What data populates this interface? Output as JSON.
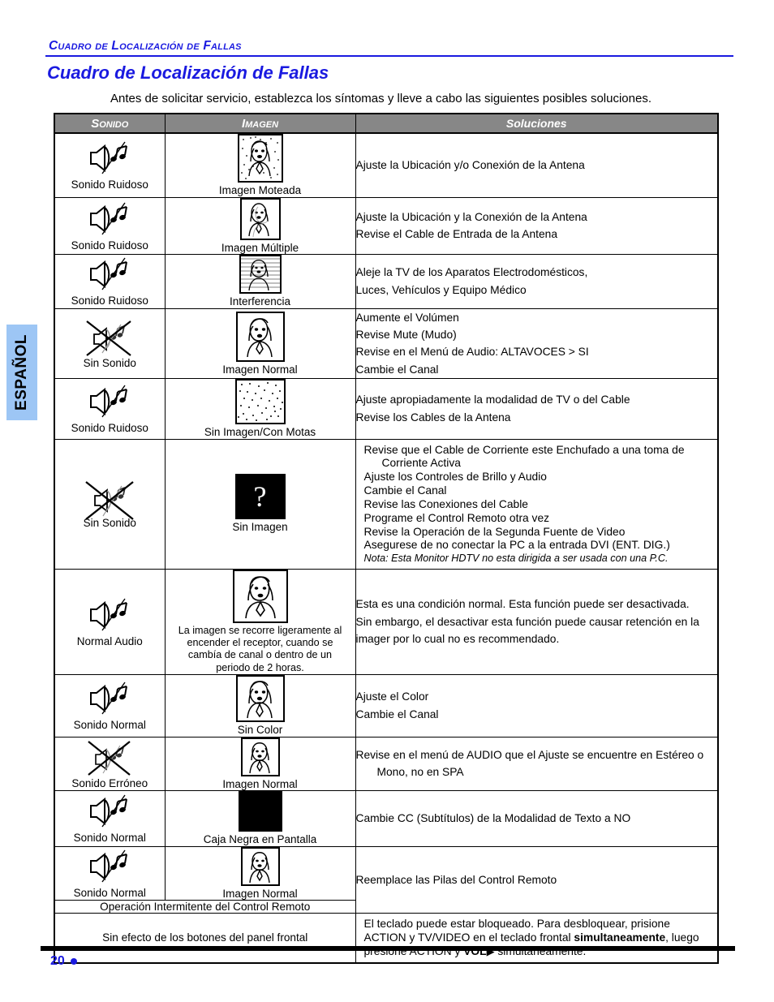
{
  "language_tab": {
    "label": "ESPAÑOL"
  },
  "header": {
    "running_head": "Cuadro de Localización de Fallas",
    "title": "Cuadro de Localización de Fallas",
    "intro": "Antes de solicitar servicio, establezca los síntomas y lleve a cabo las siguientes posibles soluciones."
  },
  "table": {
    "columns": [
      "Sonido",
      "Imagen",
      "Soluciones"
    ],
    "rows": [
      {
        "sound_icon": "speaker-noisy-icon",
        "sound_label": "Sonido Ruidoso",
        "picture_icon": "face-speckled-icon",
        "picture_label": "Imagen Moteada",
        "solutions": [
          "Ajuste la Ubicación y/o Conexión de la Antena"
        ]
      },
      {
        "sound_icon": "speaker-noisy-icon",
        "sound_label": "Sonido Ruidoso",
        "picture_icon": "face-ghost-icon",
        "picture_label": "Imagen Múltiple",
        "solutions": [
          "Ajuste la Ubicación y la Conexión de la Antena",
          "Revise el Cable de Entrada de la Antena"
        ]
      },
      {
        "sound_icon": "speaker-noisy-icon",
        "sound_label": "Sonido Ruidoso",
        "picture_icon": "face-interference-icon",
        "picture_label": "Interferencia",
        "solutions": [
          "Aleje la TV de los Aparatos Electrodomésticos,",
          "Luces, Vehículos y Equipo Médico"
        ]
      },
      {
        "sound_icon": "speaker-muted-icon",
        "sound_label": "Sin Sonido",
        "picture_icon": "face-normal-icon",
        "picture_label": "Imagen Normal",
        "solutions": [
          "Aumente el Volúmen",
          "Revise Mute (Mudo)",
          "Revise en el Menú de Audio: ALTAVOCES > SI",
          "Cambie el Canal"
        ]
      },
      {
        "sound_icon": "speaker-noisy-icon",
        "sound_label": "Sonido Ruidoso",
        "picture_icon": "snow-icon",
        "picture_label": "Sin Imagen/Con Motas",
        "solutions": [
          "Ajuste apropiadamente la modalidad de TV o del Cable",
          "Revise los Cables de la Antena"
        ]
      },
      {
        "sound_icon": "speaker-muted-icon",
        "sound_label": "Sin Sonido",
        "picture_icon": "question-box-icon",
        "picture_label": "Sin Imagen",
        "solutions": [
          "Revise que el Cable de Corriente este Enchufado a una toma de",
          "Corriente Activa",
          "Ajuste los Controles de Brillo y Audio",
          "Cambie el Canal",
          "Revise las Conexiones del Cable",
          "Programe el Control Remoto otra vez",
          "Revise la Operación de la Segunda Fuente de Video",
          "Asegurese de no conectar la PC a la entrada DVI (ENT. DIG.)"
        ],
        "note": "Nota:  Esta Monitor HDTV no esta dirigida a ser usada con una P.C."
      },
      {
        "sound_icon": "speaker-noisy-icon",
        "sound_label": "Normal Audio",
        "picture_icon": "face-normal-icon",
        "picture_label": "La imagen se recorre ligeramente al encender el receptor, cuando se cambía de canal o dentro de un periodo de 2 horas.",
        "solutions": [
          "Esta es una condición normal. Esta función puede ser desactivada.",
          "Sin embargo, el desactivar esta función puede causar retención en la",
          "imager por lo cual no es recommendado."
        ]
      },
      {
        "sound_icon": "speaker-noisy-icon",
        "sound_label": "Sonido Normal",
        "picture_icon": "face-normal-icon",
        "picture_label": "Sin Color",
        "solutions": [
          "Ajuste el Color",
          "Cambie el Canal"
        ]
      },
      {
        "sound_icon": "speaker-muted-icon",
        "sound_label": "Sonido Erróneo",
        "picture_icon": "face-normal-icon",
        "picture_label": "Imagen Normal",
        "solutions": [
          "Revise en el menú de AUDIO que el Ajuste se encuentre en Estéreo o",
          "Mono, no en SPA"
        ]
      },
      {
        "sound_icon": "speaker-noisy-icon",
        "sound_label": "Sonido Normal",
        "picture_icon": "black-box-icon",
        "picture_label": "Caja Negra en Pantalla",
        "solutions": [
          "Cambie CC (Subtítulos) de la Modalidad de Texto a NO"
        ]
      },
      {
        "sound_icon": "speaker-noisy-icon",
        "sound_label": "Sonido Normal",
        "picture_icon": "face-normal-icon",
        "picture_label": "Imagen Normal",
        "solutions": [
          "Reemplace las Pilas del Control Remoto"
        ]
      }
    ],
    "span_row_remote": "Operación Intermitente del Control Remoto",
    "span_row_panel": "Sin efecto de los botones del panel frontal",
    "panel_solution": {
      "line1": "El teclado puede estar bloqueado. Para desbloquear, prisione",
      "line2_a": "ACTION y TV/VIDEO en el teclado frontal ",
      "line2_bold": "simultaneamente",
      "line2_b": ", luego",
      "line3_a": "presione  ACTION y ",
      "line3_bold": "VOL",
      "line3_tri": "▶",
      "line3_b": " simultaneamente."
    }
  },
  "footer": {
    "page_number": "20"
  },
  "colors": {
    "accent_blue": "#1a1ae0",
    "header_gray": "#878787",
    "tab_blue": "#9dc6f5"
  }
}
